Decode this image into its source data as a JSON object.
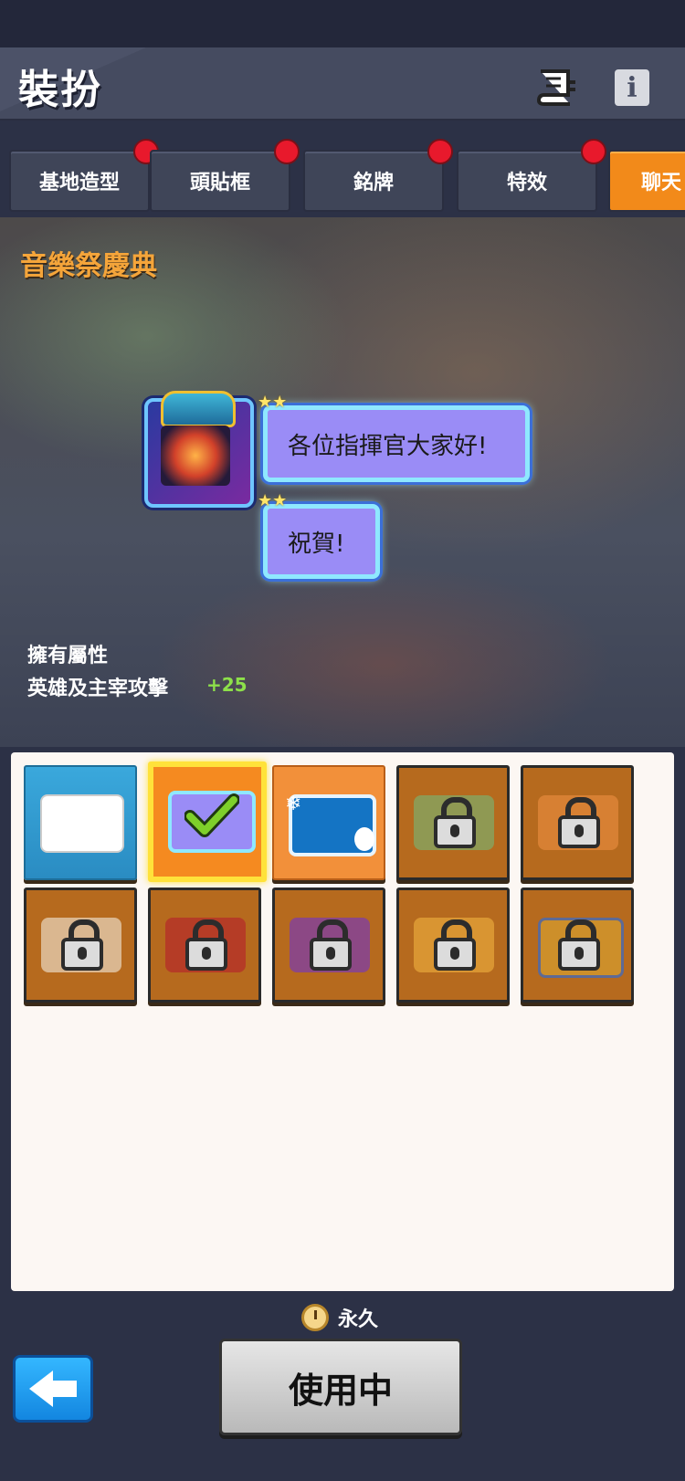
{
  "header": {
    "title": "裝扮"
  },
  "tabs": [
    {
      "label": "基地造型",
      "has_badge": true
    },
    {
      "label": "頭貼框",
      "has_badge": true
    },
    {
      "label": "銘牌",
      "has_badge": true
    },
    {
      "label": "特效",
      "has_badge": true
    },
    {
      "label": "聊天",
      "active": true
    }
  ],
  "preview": {
    "event_name": "音樂祭慶典",
    "messages": [
      "各位指揮官大家好!",
      "祝賀!"
    ]
  },
  "attributes": {
    "label": "擁有屬性",
    "name": "英雄及主宰攻擊",
    "bonus": "+25"
  },
  "items": [
    {
      "state": "owned",
      "style": "plain-white"
    },
    {
      "state": "selected",
      "style": "music-fest"
    },
    {
      "state": "owned",
      "style": "snowman"
    },
    {
      "state": "locked",
      "style": "green"
    },
    {
      "state": "locked",
      "style": "gifts"
    },
    {
      "state": "locked",
      "style": "easter"
    },
    {
      "state": "locked",
      "style": "red-candy"
    },
    {
      "state": "locked",
      "style": "halloween"
    },
    {
      "state": "locked",
      "style": "autumn"
    },
    {
      "state": "locked",
      "style": "winter"
    }
  ],
  "footer": {
    "duration": "永久",
    "use_button": "使用中"
  },
  "colors": {
    "accent": "#f28a1a",
    "event_title": "#f5a53a",
    "bonus": "#8de04a"
  }
}
